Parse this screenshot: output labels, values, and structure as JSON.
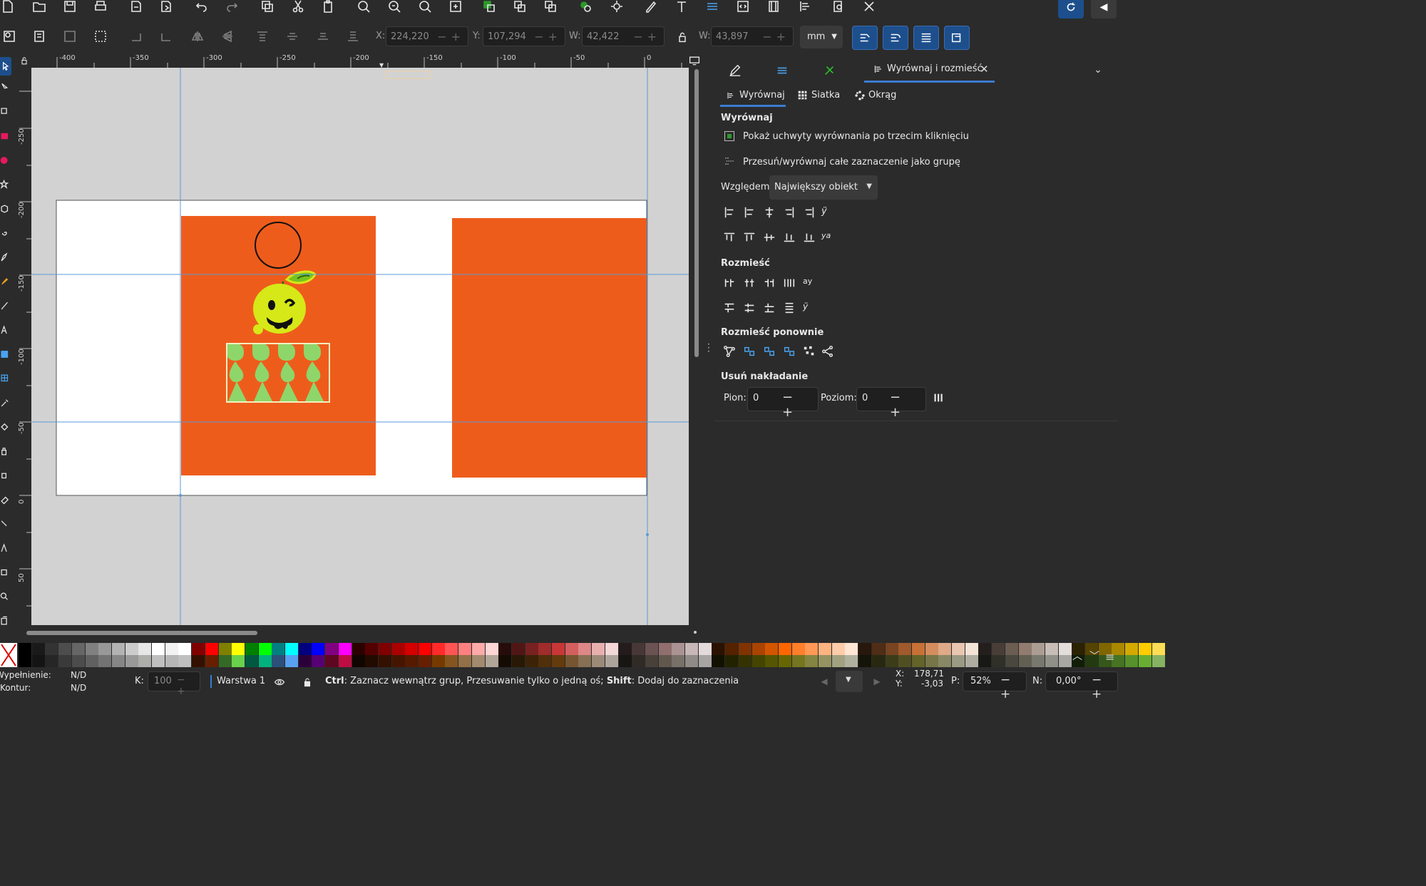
{
  "toolbar_top": {
    "x_label": "X:",
    "x_value": "224,220",
    "y_label": "Y:",
    "y_value": "107,294",
    "w_label": "W:",
    "w_value": "42,422",
    "h_label": "W:",
    "h_value": "43,897",
    "unit": "mm"
  },
  "ruler": {
    "h_ticks": [
      "-400",
      "-350",
      "-300",
      "-250",
      "-200",
      "-150",
      "-100",
      "-50",
      "0"
    ],
    "v_ticks": [
      "-250",
      "-200",
      "-150",
      "-100",
      "-50",
      "0",
      "50"
    ]
  },
  "panel": {
    "tab_title": "Wyrównaj i rozmieść",
    "subtabs": [
      "Wyrównaj",
      "Siatka",
      "Okrąg"
    ],
    "align_header": "Wyrównaj",
    "option1": "Pokaż uchwyty wyrównania po trzecim kliknięciu",
    "option2": "Przesuń/wyrównaj całe zaznaczenie jako grupę",
    "relative_label": "Względem:",
    "relative_value": "Największy obiekt",
    "distribute_header": "Rozmieść",
    "rearrange_header": "Rozmieść ponownie",
    "overlap_header": "Usuń nakładanie",
    "vert_label": "Pion:",
    "vert_value": "0",
    "horiz_label": "Poziom:",
    "horiz_value": "0"
  },
  "statusbar": {
    "fill_label": "Wypełnienie:",
    "fill_value": "N/D",
    "stroke_label": "Kontur:",
    "stroke_value": "N/D",
    "opacity_label": "K:",
    "opacity_value": "100",
    "layer": "Warstwa 1",
    "hint_ctrl": "Ctrl",
    "hint_text1": ": Zaznacz wewnątrz grup, Przesuwanie tylko o jedną oś; ",
    "hint_shift": "Shift",
    "hint_text2": ": Dodaj do zaznaczenia",
    "coord_x_label": "X:",
    "coord_x": "178,71",
    "coord_y_label": "Y:",
    "coord_y": "-3,03",
    "zoom_label": "P:",
    "zoom": "52%",
    "rotate_label": "N:",
    "rotate": "0,00°"
  },
  "colors": {
    "orange": "#ee5c1c",
    "lime": "#d6e817",
    "leaf": "#79c21f",
    "pattern_green": "#8ed66a",
    "guide": "#5a9ad8",
    "accent_blue": "#1d4f8d"
  },
  "palette": [
    "#000000",
    "#1a1a1a",
    "#333333",
    "#4d4d4d",
    "#666666",
    "#808080",
    "#999999",
    "#b3b3b3",
    "#cccccc",
    "#e6e6e6",
    "#ffffff",
    "#f2f2f2",
    "#ffffff",
    "#800000",
    "#ff0000",
    "#808000",
    "#ffff00",
    "#008000",
    "#00ff00",
    "#008080",
    "#00ffff",
    "#000080",
    "#0000ff",
    "#800080",
    "#ff00ff",
    "#2b0000",
    "#550000",
    "#800000",
    "#aa0000",
    "#d40000",
    "#ff0000",
    "#ff2a2a",
    "#ff5555",
    "#ff8080",
    "#ffaaaa",
    "#ffd5d5",
    "#280b0b",
    "#501616",
    "#782121",
    "#a02c2c",
    "#c83737",
    "#d35f5f",
    "#de8787",
    "#e9afaf",
    "#f4d7d7",
    "#241c1c",
    "#483737",
    "#6c5353",
    "#916f6f",
    "#ac9393",
    "#c8b7b7",
    "#e3dbdb",
    "#2b1100",
    "#552200",
    "#803300",
    "#aa4400",
    "#d45500",
    "#ff6600",
    "#ff7f2a",
    "#ff9955",
    "#ffb380",
    "#ffccaa",
    "#ffe6d5",
    "#28170b",
    "#502d16",
    "#784421",
    "#a05a2c",
    "#c87137",
    "#d38d5f",
    "#deaa87",
    "#e9c6af",
    "#f4e3d7",
    "#241f1c",
    "#483e37",
    "#6c5d53",
    "#917c6f",
    "#ac9d93",
    "#c8beb7",
    "#e3dedb",
    "#2b2200",
    "#554400",
    "#806600",
    "#aa8800",
    "#d4aa00",
    "#ffcc00",
    "#ffdd55"
  ]
}
